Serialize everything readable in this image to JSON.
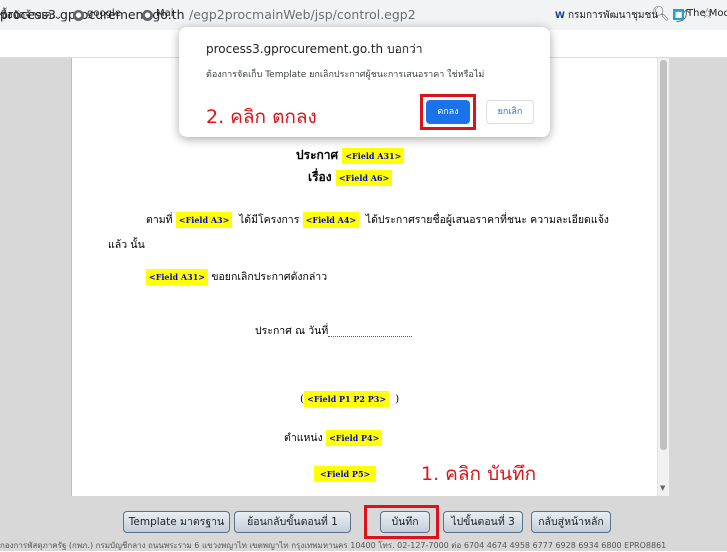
{
  "browser": {
    "url_host": "process3.gprocurement.go.th",
    "url_path": "/egp2procmainWeb/jsp/control.egp2",
    "icons": [
      "zoom-icon",
      "share-icon",
      "star-icon"
    ]
  },
  "bookmarks": [
    {
      "label": "ซื้อจัดจ้างเค...",
      "icon": "folder"
    },
    {
      "label": "google",
      "icon": "globe"
    },
    {
      "label": "Mai",
      "icon": "globe"
    },
    {
      "label": "กรมการพัฒนาชุมชน",
      "icon": "w-logo"
    },
    {
      "label": "The Mod",
      "icon": "square"
    }
  ],
  "document": {
    "announce_label": "ประกาศ",
    "subject_label": "เรื่อง",
    "body_prefix": "ตามที่",
    "body_project": "ได้มีโครงการ",
    "body_rest": "ได้ประกาศรายชื่อผู้เสนอราคาที่ชนะ ความละเอียดแจ้ง",
    "body_line2": "แล้ว นั้น",
    "cancel_text": "ขอยกเลิกประกาศดังกล่าว",
    "date_label": "ประกาศ ณ วันที่",
    "paren_open": "(",
    "paren_close": ")",
    "position_label": "ตำแหน่ง",
    "fields": {
      "a31": "<Field A31>",
      "a6": "<Field A6>",
      "a3": "<Field A3>",
      "a4": "<Field A4>",
      "p1p2p3": "<Field P1 P2 P3>",
      "p4": "<Field P4>",
      "p5": "<Field P5>"
    }
  },
  "buttons": {
    "template": "Template มาตรฐาน",
    "back": "ย้อนกลับขั้นตอนที่ 1",
    "save": "บันทึก",
    "next": "ไปขั้นตอนที่ 3",
    "home": "กลับสู่หน้าหลัก"
  },
  "footer": "กองการพัสดุภาครัฐ (กพภ.) กรมบัญชีกลาง ถนนพระราม 6 แขวงพญาไท เขตพญาไท กรุงเทพมหานคร 10400 โทร. 02-127-7000 ต่อ 6704 4674 4958 6777 6928 6934 6800    EPRO8861",
  "dialog": {
    "title": "process3.gprocurement.go.th บอกว่า",
    "message": "ต้องการจัดเก็บ Template ยกเลิกประกาศผู้ชนะการเสนอราคา ใช่หรือไม่",
    "ok_label": "ตกลง",
    "cancel_label": "ยกเลิก"
  },
  "annotations": {
    "step1": "1. คลิก บันทึก",
    "step2": "2. คลิก ตกลง",
    "color": "#d9151b"
  }
}
